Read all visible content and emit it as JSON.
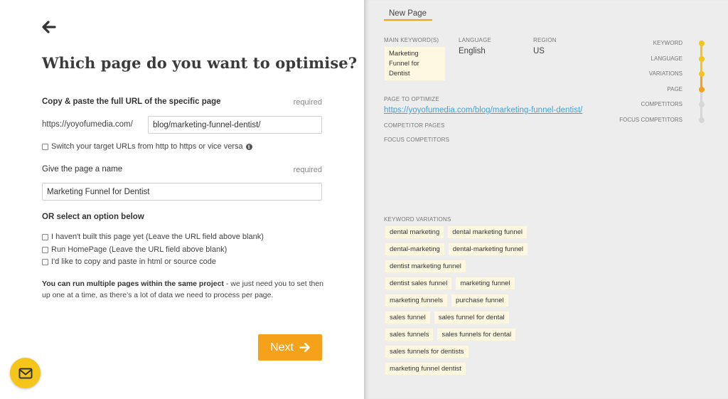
{
  "left": {
    "title": "Which page do you want to optimise?",
    "url_label": "Copy & paste the full URL of the specific page",
    "url_required": "required",
    "domain_prefix": "https://yoyofumedia.com/",
    "url_value": "blog/marketing-funnel-dentist/",
    "switch_https_label": "Switch your target URLs from http to https or vice versa",
    "name_label": "Give the page a name",
    "name_required": "required",
    "name_value": "Marketing Funnel for Dentist",
    "or_label": "OR select an option below",
    "options": [
      "I haven't built this page yet (Leave the URL field above blank)",
      "Run HomePage (Leave the URL field above blank)",
      "I'd like to copy and paste in html or source code"
    ],
    "note_bold": "You can run multiple pages within the same project",
    "note_rest": " - we just need you to set then up one at a time, as there's a lot of data we need to process per page.",
    "next_label": "Next"
  },
  "right": {
    "tab_label": "New Page",
    "main_keyword_label": "MAIN KEYWORD(S)",
    "main_keyword_value": "Marketing Funnel for Dentist",
    "language_label": "LANGUAGE",
    "language_value": "English",
    "region_label": "REGION",
    "region_value": "US",
    "page_label": "PAGE TO OPTIMIZE",
    "page_value": "https://yoyofumedia.com/blog/marketing-funnel-dentist/",
    "competitor_pages_label": "COMPETITOR PAGES",
    "focus_competitors_label": "FOCUS COMPETITORS",
    "keyword_variations_label": "KEYWORD VARIATIONS",
    "keyword_variations": [
      "dental marketing",
      "dental marketing funnel",
      "dental-marketing",
      "dental-marketing funnel",
      "dentist marketing funnel",
      "dentist sales funnel",
      "marketing funnel",
      "marketing funnels",
      "purchase funnel",
      "sales funnel",
      "sales funnel for dental",
      "sales funnels",
      "sales funnels for dental",
      "sales funnels for dentists",
      "marketing funnel dentist"
    ],
    "steps": [
      {
        "label": "KEYWORD",
        "state": "done"
      },
      {
        "label": "LANGUAGE",
        "state": "done"
      },
      {
        "label": "VARIATIONS",
        "state": "done"
      },
      {
        "label": "PAGE",
        "state": "current"
      },
      {
        "label": "COMPETITORS",
        "state": "todo"
      },
      {
        "label": "FOCUS COMPETITORS",
        "state": "todo"
      }
    ]
  },
  "colors": {
    "accent_orange": "#f5a11a",
    "accent_yellow": "#f5c51a",
    "link_blue": "#3fa3d9",
    "tag_bg": "#fff8e0",
    "panel_bg": "#ededed"
  },
  "icons": {
    "back": "arrow-left-icon",
    "next": "arrow-right-icon",
    "info": "info-icon",
    "mail": "envelope-icon"
  }
}
